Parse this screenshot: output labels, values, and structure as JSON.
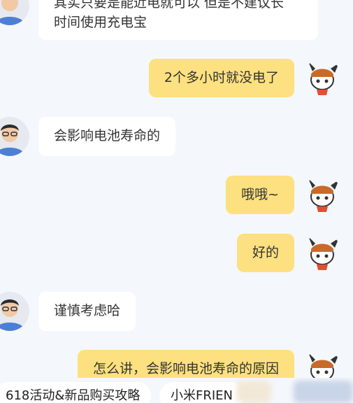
{
  "messages": [
    {
      "side": "left",
      "text": "其实只要是能近电就可以 但是不建议长\n时间使用充电宝"
    },
    {
      "side": "right",
      "text": "2个多小时就没电了"
    },
    {
      "side": "left",
      "text": "会影响电池寿命的"
    },
    {
      "side": "right",
      "text": "哦哦~"
    },
    {
      "side": "right",
      "text": "好的"
    },
    {
      "side": "left",
      "text": "谨慎考虑哈"
    },
    {
      "side": "right",
      "text": "怎么讲，会影响电池寿命的原因"
    }
  ],
  "quick_replies": [
    {
      "label": "618活动&新品购买攻略"
    },
    {
      "label": "小米FRIEN"
    }
  ],
  "avatars": {
    "agent": "agent-avatar",
    "user": "mitu-bunny-avatar"
  }
}
